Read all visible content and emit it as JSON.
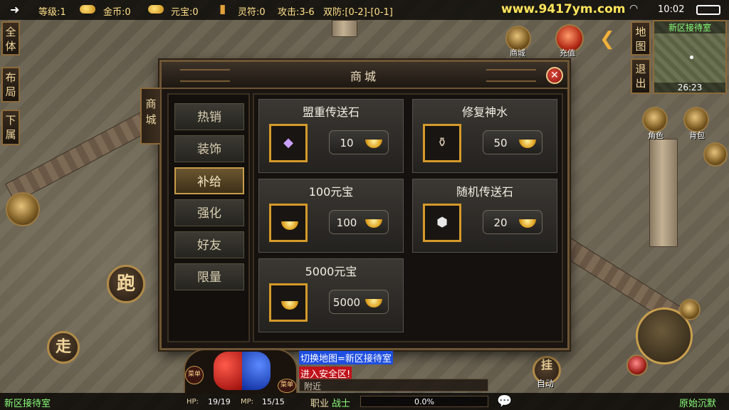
{
  "status": {
    "level": "等级:1",
    "gold": "金币:0",
    "ingot": "元宝:0",
    "talisman": "灵符:0",
    "attack": "攻击:3-6",
    "defense": "双防:[0-2]-[0-1]",
    "site": "www.9417ym.com",
    "time": "10:02"
  },
  "left_buttons": [
    "全体",
    "布局",
    "下属"
  ],
  "top_icons": {
    "shop": "商城",
    "recharge": "充值"
  },
  "right_buttons": [
    "地图",
    "退出"
  ],
  "minimap": {
    "title": "新区接待室",
    "time": "26:23"
  },
  "side_icons": {
    "role": "角色",
    "bag": "背包"
  },
  "actions": {
    "run": "跑",
    "walk": "走",
    "auto_top": "挂",
    "auto_bottom": "自动",
    "bottle_left": "菜单",
    "bottle_right": "菜单"
  },
  "shop": {
    "title": "商城",
    "side_tab": "商城",
    "categories": [
      {
        "label": "热销",
        "selected": false
      },
      {
        "label": "装饰",
        "selected": false
      },
      {
        "label": "补给",
        "selected": true
      },
      {
        "label": "强化",
        "selected": false
      },
      {
        "label": "好友",
        "selected": false
      },
      {
        "label": "限量",
        "selected": false
      }
    ],
    "items": [
      {
        "name": "盟重传送石",
        "price": "10",
        "icon": "teleport-stone-icon"
      },
      {
        "name": "修复神水",
        "price": "50",
        "icon": "repair-potion-icon"
      },
      {
        "name": "100元宝",
        "price": "100",
        "icon": "gold-ingot-icon"
      },
      {
        "name": "随机传送石",
        "price": "20",
        "icon": "random-stone-icon"
      },
      {
        "name": "5000元宝",
        "price": "5000",
        "icon": "gold-ingot-icon"
      }
    ]
  },
  "chat": {
    "line1": "切换地图=新区接待室",
    "line2": "进入安全区!",
    "channel": "附近"
  },
  "bottom": {
    "map_name": "新区接待室",
    "hp_label": "HP:",
    "hp": "19/19",
    "mp_label": "MP:",
    "mp": "15/15",
    "job_label": "职业",
    "job": "战士",
    "exp": "0.0%",
    "exp_fraction": 0.0,
    "mode": "原始沉默"
  },
  "colors": {
    "accent_gold": "#ffe08a",
    "chat_blue_bg": "#1f4fe0",
    "chat_red_bg": "#c0121a",
    "map_green": "#8aff7a"
  }
}
